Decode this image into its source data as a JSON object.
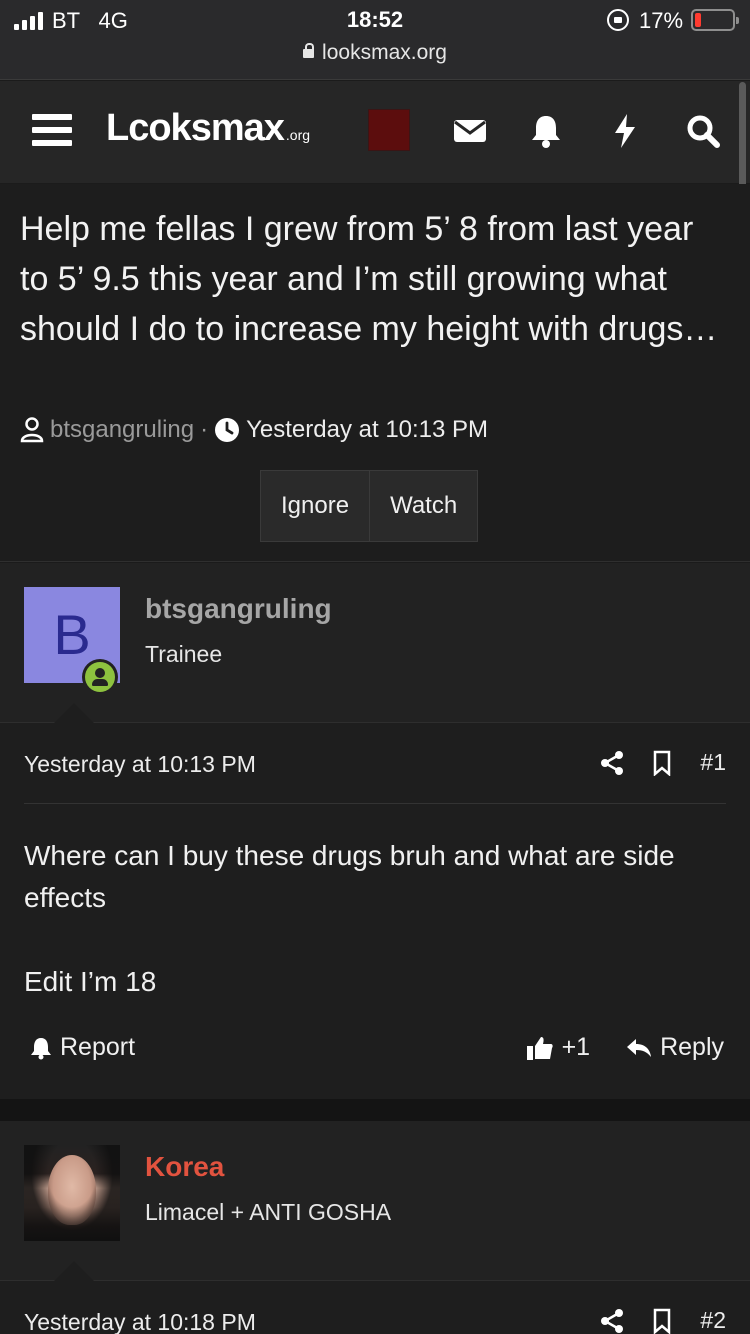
{
  "status_bar": {
    "carrier": "BT",
    "network": "4G",
    "time": "18:52",
    "battery": "17%",
    "battery_level": 0.17,
    "url": "looksmax.org"
  },
  "nav": {
    "logo": "Lcoksmax",
    "logo_suffix": ".org",
    "icons": [
      "menu-icon",
      "mail-icon",
      "bell-icon",
      "bolt-icon",
      "search-icon"
    ]
  },
  "thread": {
    "title": "Help me fellas I grew from 5’ 8 from last year to 5’ 9.5 this year and I’m still growing what should I do to increase my height with drugs…",
    "author": "btsgangruling",
    "separator": "·",
    "time": "Yesterday at 10:13 PM",
    "buttons": {
      "ignore": "Ignore",
      "watch": "Watch"
    }
  },
  "posts": [
    {
      "user": {
        "initial": "B",
        "name": "btsgangruling",
        "title": "Trainee",
        "avatar_color": "#8a87e0"
      },
      "time": "Yesterday at 10:13 PM",
      "number": "#1",
      "body": [
        "Where can I buy these drugs bruh and what are side effects",
        "Edit I’m 18"
      ],
      "report": "Report",
      "likes": "+1",
      "reply": "Reply"
    },
    {
      "user": {
        "name": "Korea",
        "title": "Limacel + ANTI GOSHA",
        "name_color": "#e2533f"
      },
      "time": "Yesterday at 10:18 PM",
      "number": "#2"
    }
  ]
}
